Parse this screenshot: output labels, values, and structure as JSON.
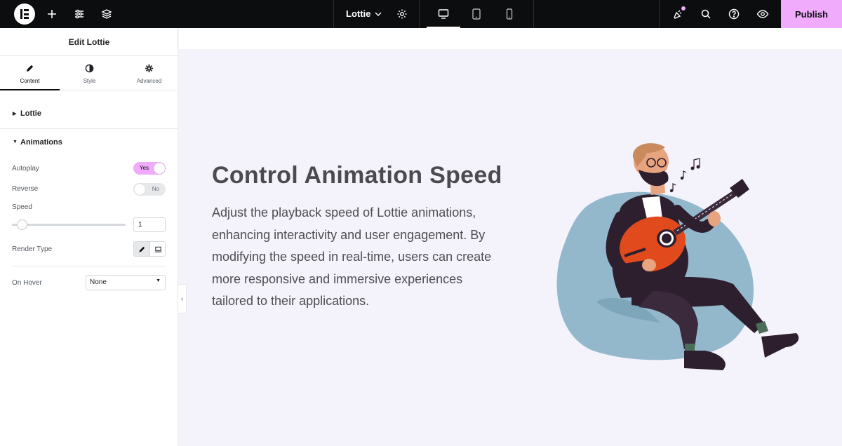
{
  "topbar": {
    "page_title": "Lottie",
    "publish_label": "Publish",
    "icons": [
      "elementor-logo",
      "add-icon",
      "settings-sliders-icon",
      "layers-icon",
      "chevron-down-icon",
      "gear-icon",
      "desktop-icon",
      "tablet-icon",
      "mobile-icon",
      "notes-icon",
      "search-icon",
      "help-icon",
      "preview-eye-icon"
    ],
    "accent_color": "#f0abfc"
  },
  "panel": {
    "title": "Edit Lottie",
    "tabs": [
      {
        "label": "Content",
        "icon": "pencil-icon",
        "active": true
      },
      {
        "label": "Style",
        "icon": "half-circle-icon",
        "active": false
      },
      {
        "label": "Advanced",
        "icon": "gear-icon",
        "active": false
      }
    ],
    "sections": {
      "lottie": "Lottie",
      "animations": "Animations"
    },
    "controls": {
      "autoplay": {
        "label": "Autoplay",
        "value": "Yes"
      },
      "reverse": {
        "label": "Reverse",
        "value": "No"
      },
      "speed": {
        "label": "Speed",
        "value": "1"
      },
      "render_type": {
        "label": "Render Type"
      },
      "on_hover": {
        "label": "On Hover",
        "value": "None"
      }
    }
  },
  "canvas": {
    "heading": "Control Animation Speed",
    "paragraph": "Adjust the playback speed of Lottie animations, enhancing interactivity and user engagement. By modifying the speed in real-time, users can create more responsive and immersive experiences tailored to their applications."
  }
}
